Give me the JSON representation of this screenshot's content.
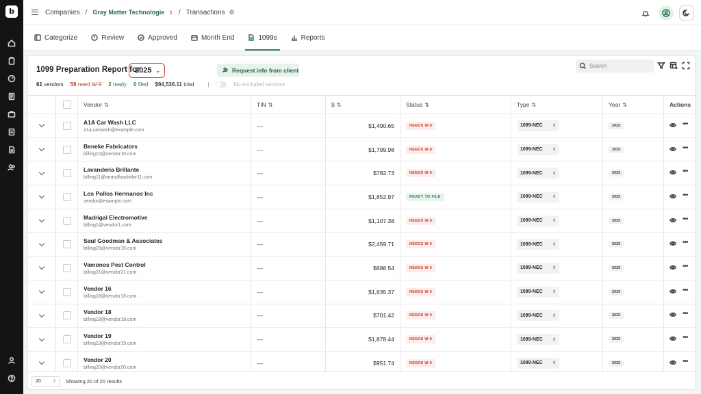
{
  "breadcrumb": {
    "companies": "Companies",
    "company": "Gray Matter Technologie",
    "page": "Transactions"
  },
  "tabs": [
    {
      "label": "Categorize",
      "icon": "categorize-icon"
    },
    {
      "label": "Review",
      "icon": "review-icon"
    },
    {
      "label": "Approved",
      "icon": "approved-icon"
    },
    {
      "label": "Month End",
      "icon": "calendar-icon"
    },
    {
      "label": "1099s",
      "icon": "document-icon",
      "active": true
    },
    {
      "label": "Reports",
      "icon": "chart-icon"
    }
  ],
  "report": {
    "title": "1099 Preparation Report for",
    "year": "2025",
    "request_label": "Request info from client",
    "search_placeholder": "Search"
  },
  "stats": {
    "vendors_count": "61",
    "vendors_label": "vendors",
    "needs_count": "59",
    "needs_label": "need W-9",
    "ready_count": "2",
    "ready_label": "ready",
    "filed_count": "0",
    "filed_label": "filed",
    "total_amount": "$94,536.11",
    "total_label": "total",
    "excluded_label": "No excluded vendors"
  },
  "columns": {
    "vendor": "Vendor",
    "tin": "TIN",
    "amount": "$",
    "status": "Status",
    "type": "Type",
    "year": "Year",
    "actions": "Actions"
  },
  "rows": [
    {
      "name": "A1A Car Wash LLC",
      "email": "a1a.carwash@example.com",
      "tin": "—",
      "amount": "$1,490.65",
      "status": "NEEDS W-9",
      "status_kind": "needs",
      "type": "1099-NEC",
      "year": "2025"
    },
    {
      "name": "Beneke Fabricators",
      "email": "billing10@vendor10.com",
      "tin": "—",
      "amount": "$1,799.98",
      "status": "NEEDS W-9",
      "status_kind": "needs",
      "type": "1099-NEC",
      "year": "2025"
    },
    {
      "name": "Lavanderia Brillante",
      "email": "billing11@veasdfsadndor11.com",
      "tin": "—",
      "amount": "$782.73",
      "status": "NEEDS W-9",
      "status_kind": "needs",
      "type": "1099-NEC",
      "year": "2025"
    },
    {
      "name": "Los Pollos Hermanos Inc",
      "email": "vendor@example.com",
      "tin": "—",
      "amount": "$1,852.97",
      "status": "READY TO FILE",
      "status_kind": "ready",
      "type": "1099-NEC",
      "year": "2025"
    },
    {
      "name": "Madrigal Electromotive",
      "email": "billing1@vendor1.com",
      "tin": "—",
      "amount": "$1,107.38",
      "status": "NEEDS W-9",
      "status_kind": "needs",
      "type": "1099-NEC",
      "year": "2025"
    },
    {
      "name": "Saul Goodman & Associates",
      "email": "billing15@vendor15.com",
      "tin": "—",
      "amount": "$2,459.71",
      "status": "NEEDS W-9",
      "status_kind": "needs",
      "type": "1099-NEC",
      "year": "2025"
    },
    {
      "name": "Vamonos Pest Control",
      "email": "billing21@vendor21.com",
      "tin": "—",
      "amount": "$698.54",
      "status": "NEEDS W-9",
      "status_kind": "needs",
      "type": "1099-NEC",
      "year": "2025"
    },
    {
      "name": "Vendor 16",
      "email": "billing16@vendor16.com",
      "tin": "—",
      "amount": "$1,635.37",
      "status": "NEEDS W-9",
      "status_kind": "needs",
      "type": "1099-NEC",
      "year": "2025"
    },
    {
      "name": "Vendor 18",
      "email": "billing18@vendor18.com",
      "tin": "—",
      "amount": "$701.42",
      "status": "NEEDS W-9",
      "status_kind": "needs",
      "type": "1099-NEC",
      "year": "2025"
    },
    {
      "name": "Vendor 19",
      "email": "billing19@vendor19.com",
      "tin": "—",
      "amount": "$1,878.44",
      "status": "NEEDS W-9",
      "status_kind": "needs",
      "type": "1099-NEC",
      "year": "2025"
    },
    {
      "name": "Vendor 20",
      "email": "billing20@vendor20.com",
      "tin": "—",
      "amount": "$951.74",
      "status": "NEEDS W-9",
      "status_kind": "needs",
      "type": "1099-NEC",
      "year": "2025"
    }
  ],
  "footer": {
    "page_size": "20",
    "showing": "Showing 20 of 20 results"
  },
  "colors": {
    "accent": "#2f7a52",
    "needs": "#c03d2a",
    "sidebar": "#141414"
  }
}
